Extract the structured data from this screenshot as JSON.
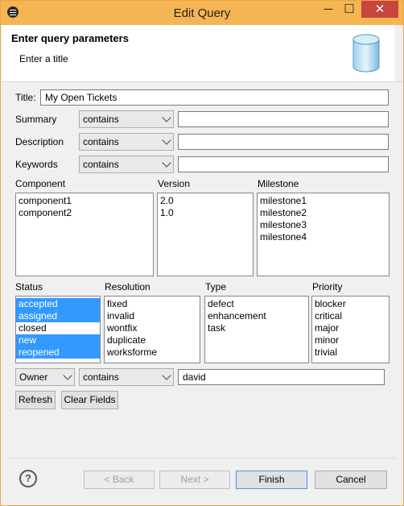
{
  "window": {
    "title": "Edit Query",
    "minimize": "─",
    "maximize": "☐",
    "close": "✕"
  },
  "banner": {
    "title": "Enter query parameters",
    "subtitle": "Enter a title"
  },
  "form": {
    "title_label": "Title:",
    "title_value": "My Open Tickets",
    "summary_label": "Summary",
    "summary_op": "contains",
    "summary_value": "",
    "description_label": "Description",
    "description_op": "contains",
    "description_value": "",
    "keywords_label": "Keywords",
    "keywords_op": "contains",
    "keywords_value": ""
  },
  "lists": {
    "component": {
      "label": "Component",
      "items": [
        "component1",
        "component2"
      ]
    },
    "version": {
      "label": "Version",
      "items": [
        "2.0",
        "1.0"
      ]
    },
    "milestone": {
      "label": "Milestone",
      "items": [
        "milestone1",
        "milestone2",
        "milestone3",
        "milestone4"
      ]
    },
    "status": {
      "label": "Status",
      "items": [
        "accepted",
        "assigned",
        "closed",
        "new",
        "reopened"
      ],
      "selected": [
        true,
        true,
        false,
        true,
        true
      ]
    },
    "resolution": {
      "label": "Resolution",
      "items": [
        "fixed",
        "invalid",
        "wontfix",
        "duplicate",
        "worksforme"
      ]
    },
    "type": {
      "label": "Type",
      "items": [
        "defect",
        "enhancement",
        "task"
      ]
    },
    "priority": {
      "label": "Priority",
      "items": [
        "blocker",
        "critical",
        "major",
        "minor",
        "trivial"
      ]
    }
  },
  "owner": {
    "field": "Owner",
    "op": "contains",
    "value": "david"
  },
  "buttons": {
    "refresh": "Refresh",
    "clear": "Clear Fields",
    "back": "< Back",
    "next": "Next >",
    "finish": "Finish",
    "cancel": "Cancel",
    "help": "?"
  },
  "colors": {
    "titlebar": "#f5b553",
    "selection": "#3399ff",
    "close": "#c7453d"
  }
}
